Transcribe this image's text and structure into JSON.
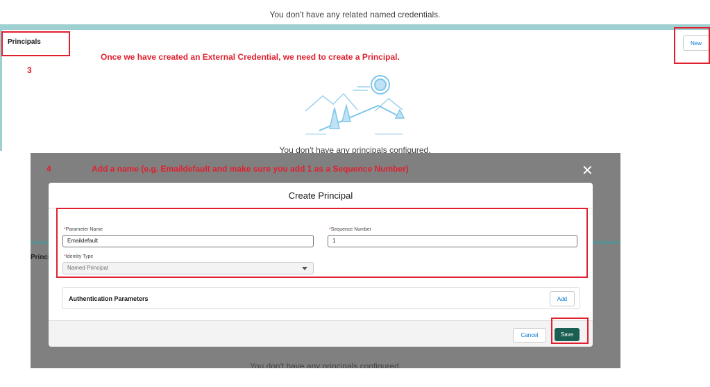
{
  "background": {
    "related_credentials_empty": "You don't have any related named credentials.",
    "principals_title": "Principals",
    "new_button": "New",
    "principals_empty": "You don't have any principals configured.",
    "partial_principals_label": "Princip"
  },
  "annotations": {
    "step3_number": "3",
    "step3_text": "Once we have created an External Credential, we need to create a Principal.",
    "step4_number": "4",
    "step4_text": "Add a name (e.g. Emaildefault and make sure you add 1 as a Sequence Number)"
  },
  "modal": {
    "title": "Create Principal",
    "close_glyph": "✕",
    "parameter_name_label": "Parameter Name",
    "parameter_name_value": "Emaildefault",
    "sequence_number_label": "Sequence Number",
    "sequence_number_value": "1",
    "identity_type_label": "Identity Type",
    "identity_type_value": "Named Principal",
    "required_marker": "*",
    "auth_params_title": "Authentication Parameters",
    "add_button": "Add",
    "cancel_button": "Cancel",
    "save_button": "Save"
  },
  "colors": {
    "annotation_red": "#e0202f",
    "save_green": "#1b5f52",
    "teal_accent": "#9ecfd1"
  }
}
